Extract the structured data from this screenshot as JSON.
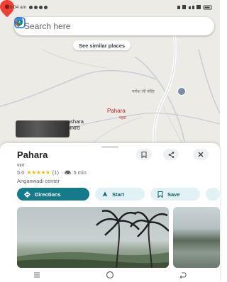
{
  "status_bar": {
    "time": "10:04 am"
  },
  "search": {
    "placeholder": "Search here"
  },
  "map": {
    "similar_places_label": "See similar places",
    "temple_label": "गणेश जी मंदिर",
    "pin_label": "Pahara",
    "pin_sublabel": "पहरा",
    "nearby_label_line1": "ashara",
    "nearby_label_line2": "आशरा"
  },
  "place": {
    "title": "Pahara",
    "native_name": "पहरा",
    "rating": "5.0",
    "stars": "★★★★★",
    "review_count": "(1)",
    "drive_time": "5 min",
    "category": "Anganwadi center"
  },
  "actions": {
    "directions_label": "Directions",
    "start_label": "Start",
    "save_label": "Save"
  },
  "icons": {
    "search_logo": "maps-pin-icon",
    "mic": "mic-icon",
    "lens": "lens-icon",
    "save": "bookmark-icon",
    "share": "share-icon",
    "close": "close-icon",
    "directions": "directions-icon",
    "start": "navigation-arrow-icon",
    "save_chip": "bookmark-icon",
    "car": "car-icon"
  },
  "colors": {
    "primary": "#137b8c",
    "pin": "#ea4335",
    "star": "#fbbc04"
  }
}
